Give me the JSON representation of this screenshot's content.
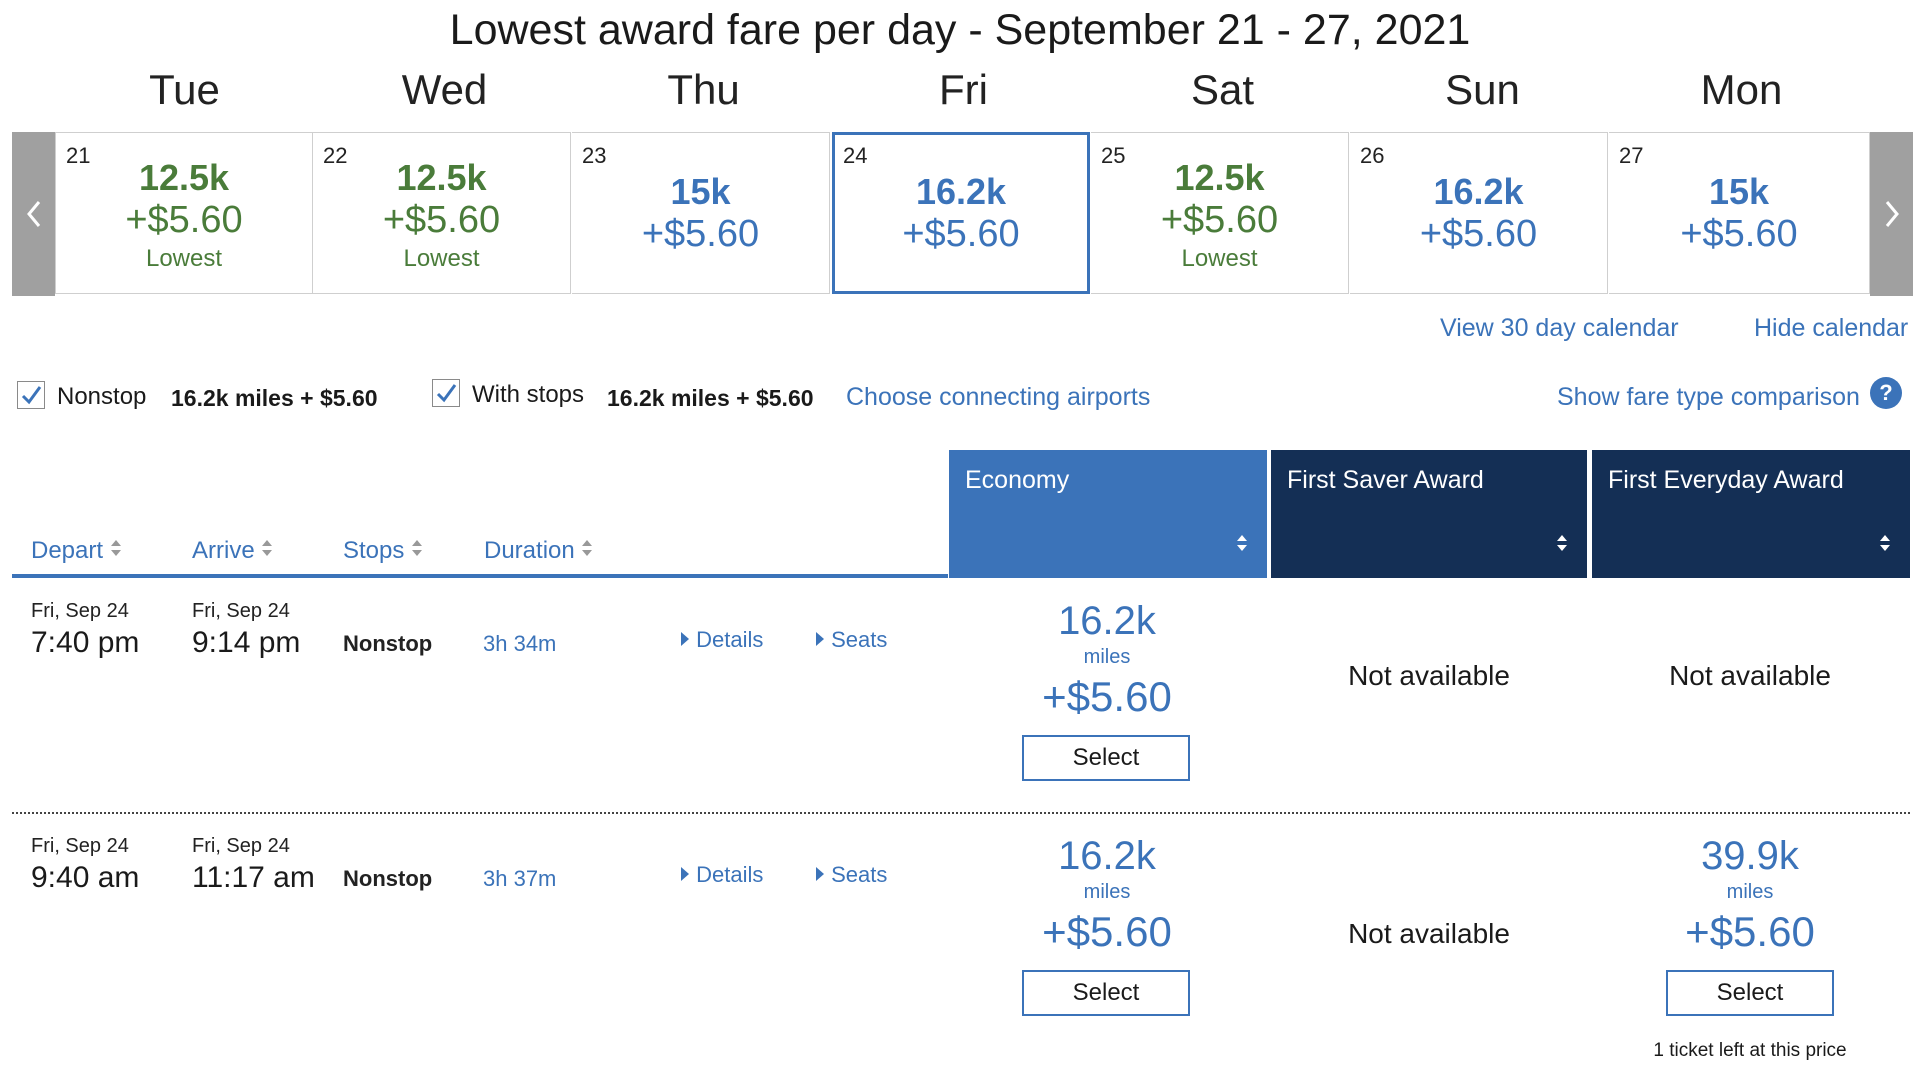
{
  "title": "Lowest award fare per day - September 21 - 27, 2021",
  "calendar": {
    "days": [
      {
        "name": "Tue",
        "num": "21",
        "miles": "12.5k",
        "fee": "+$5.60",
        "note": "Lowest",
        "color": "green"
      },
      {
        "name": "Wed",
        "num": "22",
        "miles": "12.5k",
        "fee": "+$5.60",
        "note": "Lowest",
        "color": "green"
      },
      {
        "name": "Thu",
        "num": "23",
        "miles": "15k",
        "fee": "+$5.60",
        "note": "",
        "color": "blue"
      },
      {
        "name": "Fri",
        "num": "24",
        "miles": "16.2k",
        "fee": "+$5.60",
        "note": "",
        "color": "blue",
        "selected": true
      },
      {
        "name": "Sat",
        "num": "25",
        "miles": "12.5k",
        "fee": "+$5.60",
        "note": "Lowest",
        "color": "green"
      },
      {
        "name": "Sun",
        "num": "26",
        "miles": "16.2k",
        "fee": "+$5.60",
        "note": "",
        "color": "blue"
      },
      {
        "name": "Mon",
        "num": "27",
        "miles": "15k",
        "fee": "+$5.60",
        "note": "",
        "color": "blue"
      }
    ],
    "prev_icon": "chevron-left-icon",
    "next_icon": "chevron-right-icon",
    "view_30": "View 30 day calendar",
    "hide": "Hide calendar"
  },
  "filters": {
    "nonstop_label": "Nonstop",
    "nonstop_price": "16.2k miles + $5.60",
    "stops_label": "With stops",
    "stops_price": "16.2k miles + $5.60",
    "connecting": "Choose connecting airports",
    "fare_comparison": "Show fare type comparison",
    "help_icon": "?"
  },
  "columns": {
    "depart": "Depart",
    "arrive": "Arrive",
    "stops": "Stops",
    "duration": "Duration",
    "economy": "Economy",
    "first_saver": "First Saver Award",
    "first_everyday": "First Everyday Award"
  },
  "flights": [
    {
      "depart_date": "Fri, Sep 24",
      "depart_time": "7:40 pm",
      "arrive_date": "Fri, Sep 24",
      "arrive_time": "9:14 pm",
      "stops": "Nonstop",
      "duration": "3h 34m",
      "details": "Details",
      "seats": "Seats",
      "economy": {
        "miles": "16.2k",
        "unit": "miles",
        "fee": "+$5.60",
        "select": "Select"
      },
      "first_saver": "Not available",
      "first_everyday": "Not available"
    },
    {
      "depart_date": "Fri, Sep 24",
      "depart_time": "9:40 am",
      "arrive_date": "Fri, Sep 24",
      "arrive_time": "11:17 am",
      "stops": "Nonstop",
      "duration": "3h 37m",
      "details": "Details",
      "seats": "Seats",
      "economy": {
        "miles": "16.2k",
        "unit": "miles",
        "fee": "+$5.60",
        "select": "Select"
      },
      "first_saver": "Not available",
      "first_everyday": {
        "miles": "39.9k",
        "unit": "miles",
        "fee": "+$5.60",
        "select": "Select",
        "note": "1 ticket left at this price"
      }
    }
  ],
  "colors": {
    "accent": "#3b73b9",
    "navy": "#142f55",
    "green": "#4a7c3a",
    "nav_gray": "#a0a0a0"
  }
}
